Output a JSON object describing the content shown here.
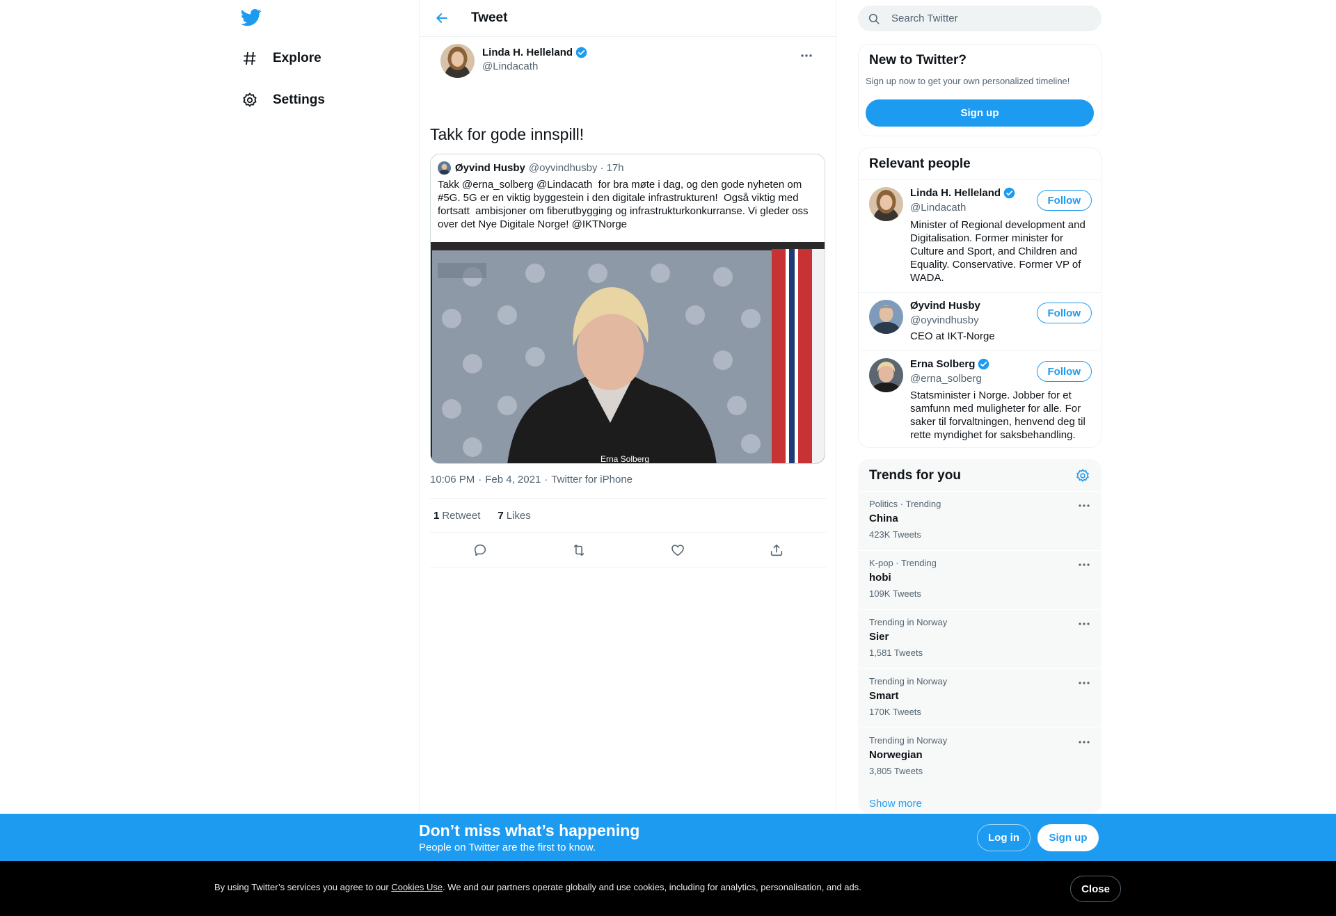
{
  "brand": {
    "logo_icon": "twitter-bird-icon",
    "accent": "#1d9bf0"
  },
  "nav": {
    "items": [
      {
        "label": "Explore",
        "icon": "hashtag-icon"
      },
      {
        "label": "Settings",
        "icon": "gear-icon"
      }
    ]
  },
  "header": {
    "title": "Tweet",
    "back_icon": "arrow-left-icon"
  },
  "tweet": {
    "author_name": "Linda H. Helleland",
    "author_handle": "@Lindacath",
    "verified": true,
    "text": "Takk for gode innspill!",
    "quote": {
      "author_name": "Øyvind Husby",
      "author_handle": "@oyvindhusby",
      "time": "17h",
      "text": "Takk @erna_solberg @Lindacath  for bra møte i dag, og den gode nyheten om #5G. 5G er en viktig byggestein i den digitale infrastrukturen!  Også viktig med fortsatt  ambisjoner om fiberutbygging og infrastrukturkonkurranse. Vi gleder oss over det Nye Digitale Norge! @IKTNorge",
      "media_caption": "Erna Solberg"
    },
    "time": "10:06 PM",
    "date": "Feb 4, 2021",
    "source": "Twitter for iPhone",
    "retweets_count": "1",
    "retweets_label": "Retweet",
    "likes_count": "7",
    "likes_label": "Likes"
  },
  "search": {
    "placeholder": "Search Twitter"
  },
  "new_to_twitter": {
    "title": "New to Twitter?",
    "subtitle": "Sign up now to get your own personalized timeline!",
    "button": "Sign up"
  },
  "relevant_people": {
    "title": "Relevant people",
    "people": [
      {
        "name": "Linda H. Helleland",
        "handle": "@Lindacath",
        "verified": true,
        "follow": "Follow",
        "bio": "Minister of Regional development and Digitalisation. Former minister for Culture and Sport, and Children and Equality. Conservative. Former VP of WADA."
      },
      {
        "name": "Øyvind Husby",
        "handle": "@oyvindhusby",
        "verified": false,
        "follow": "Follow",
        "bio": "CEO at IKT-Norge"
      },
      {
        "name": "Erna Solberg",
        "handle": "@erna_solberg",
        "verified": true,
        "follow": "Follow",
        "bio": "Statsminister i Norge. Jobber for et samfunn med muligheter for alle. For saker til forvaltningen, henvend deg til rette myndighet for saksbehandling."
      }
    ]
  },
  "trends": {
    "title": "Trends for you",
    "items": [
      {
        "context": "Politics · Trending",
        "name": "China",
        "count": "423K Tweets"
      },
      {
        "context": "K-pop · Trending",
        "name": "hobi",
        "count": "109K Tweets"
      },
      {
        "context": "Trending in Norway",
        "name": "Sier",
        "count": "1,581 Tweets"
      },
      {
        "context": "Trending in Norway",
        "name": "Smart",
        "count": "170K Tweets"
      },
      {
        "context": "Trending in Norway",
        "name": "Norwegian",
        "count": "3,805 Tweets"
      }
    ],
    "show_more": "Show more"
  },
  "bottom_bar": {
    "title": "Don’t miss what’s happening",
    "subtitle": "People on Twitter are the first to know.",
    "login": "Log in",
    "signup": "Sign up"
  },
  "cookie": {
    "text_before": "By using Twitter’s services you agree to our ",
    "link": "Cookies Use",
    "text_after": ". We and our partners operate globally and use cookies, including for analytics, personalisation, and ads.",
    "close": "Close"
  }
}
